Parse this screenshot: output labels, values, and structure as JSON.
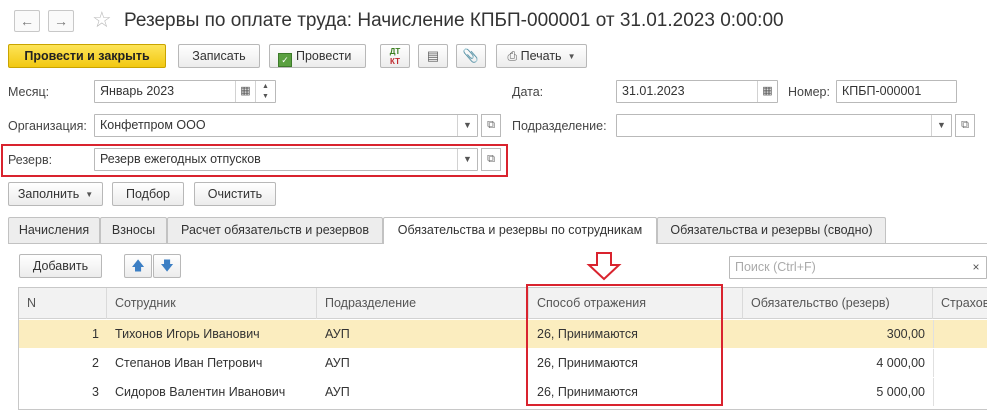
{
  "header": {
    "title": "Резервы по оплате труда: Начисление КПБП-000001 от 31.01.2023 0:00:00"
  },
  "toolbar": {
    "post_close": "Провести и закрыть",
    "save": "Записать",
    "post": "Провести",
    "dtkt_top": "ДТ",
    "dtkt_bottom": "КТ",
    "print": "Печать"
  },
  "form": {
    "month_label": "Месяц:",
    "month_value": "Январь 2023",
    "date_label": "Дата:",
    "date_value": "31.01.2023",
    "number_label": "Номер:",
    "number_value": "КПБП-000001",
    "org_label": "Организация:",
    "org_value": "Конфетпром ООО",
    "dept_label": "Подразделение:",
    "dept_value": "",
    "reserve_label": "Резерв:",
    "reserve_value": "Резерв ежегодных отпусков"
  },
  "actions": {
    "fill": "Заполнить",
    "select": "Подбор",
    "clear": "Очистить"
  },
  "tabs": [
    {
      "label": "Начисления"
    },
    {
      "label": "Взносы"
    },
    {
      "label": "Расчет обязательств и резервов"
    },
    {
      "label": "Обязательства и резервы по сотрудникам"
    },
    {
      "label": "Обязательства и резервы (сводно)"
    }
  ],
  "table_toolbar": {
    "add": "Добавить",
    "search_placeholder": "Поиск (Ctrl+F)"
  },
  "table": {
    "columns": [
      "N",
      "Сотрудник",
      "Подразделение",
      "Способ отражения",
      "Обязательство (резерв)",
      "Страхов"
    ],
    "rows": [
      {
        "n": "1",
        "employee": "Тихонов Игорь Иванович",
        "dept": "АУП",
        "method": "26, Принимаются",
        "amount": "300,00"
      },
      {
        "n": "2",
        "employee": "Степанов Иван Петрович",
        "dept": "АУП",
        "method": "26, Принимаются",
        "amount": "4 000,00"
      },
      {
        "n": "3",
        "employee": "Сидоров Валентин Иванович",
        "dept": "АУП",
        "method": "26, Принимаются",
        "amount": "5 000,00"
      }
    ]
  },
  "colors": {
    "primary_button": "#f5d020",
    "highlight_box": "#d9232e",
    "selected_row": "#fbedbf"
  }
}
